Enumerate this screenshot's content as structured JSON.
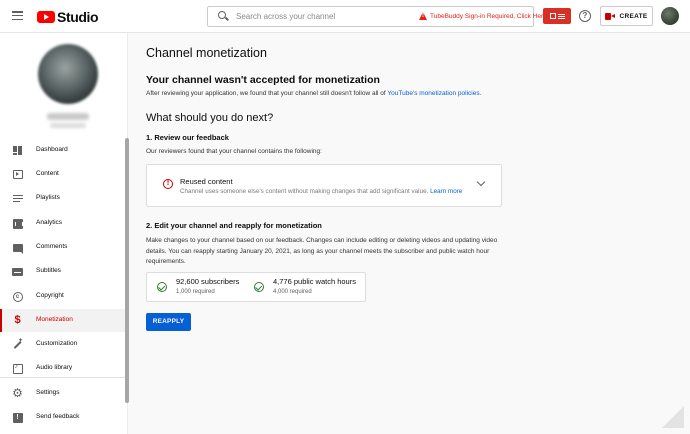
{
  "header": {
    "logo_text": "Studio",
    "search_placeholder": "Search across your channel",
    "tubebuddy_warning": "TubeBuddy Sign-in Required, Click Here",
    "create_label": "CREATE"
  },
  "sidebar": {
    "items": [
      {
        "label": "Dashboard",
        "icon": "dashboard-icon"
      },
      {
        "label": "Content",
        "icon": "content-icon"
      },
      {
        "label": "Playlists",
        "icon": "playlists-icon"
      },
      {
        "label": "Analytics",
        "icon": "analytics-icon"
      },
      {
        "label": "Comments",
        "icon": "comments-icon"
      },
      {
        "label": "Subtitles",
        "icon": "subtitles-icon"
      },
      {
        "label": "Copyright",
        "icon": "copyright-icon"
      },
      {
        "label": "Monetization",
        "icon": "monetization-icon",
        "active": true
      },
      {
        "label": "Customization",
        "icon": "customization-icon"
      },
      {
        "label": "Audio library",
        "icon": "audio-library-icon"
      }
    ],
    "bottom_items": [
      {
        "label": "Settings",
        "icon": "settings-icon"
      },
      {
        "label": "Send feedback",
        "icon": "send-feedback-icon"
      }
    ]
  },
  "main": {
    "page_title": "Channel monetization",
    "status_heading": "Your channel wasn't accepted for monetization",
    "status_desc_prefix": "After reviewing your application, we found that your channel still doesn't follow all of ",
    "status_desc_link": "YouTube's monetization policies.",
    "next_heading": "What should you do next?",
    "step1_title": "1. Review our feedback",
    "step1_desc": "Our reviewers found that your channel contains the following:",
    "feedback": {
      "title": "Reused content",
      "text": "Channel uses someone else's content without making changes that add significant value.",
      "link": "Learn more"
    },
    "step2_title": "2. Edit your channel and reapply for monetization",
    "step2_desc": "Make changes to your channel based on our feedback. Changes can include editing or deleting videos and updating video details. You can reapply starting January 20, 2021, as long as your channel meets the subscriber and public watch hour requirements.",
    "requirements": [
      {
        "value": "92,600 subscribers",
        "required": "1,000 required"
      },
      {
        "value": "4,776 public watch hours",
        "required": "4,000 required"
      }
    ],
    "reapply_label": "REAPPLY"
  },
  "colors": {
    "accent": "#065fd4",
    "brand_red": "#ff0000",
    "active_red": "#cc0000",
    "success_green": "#2e7d32"
  }
}
